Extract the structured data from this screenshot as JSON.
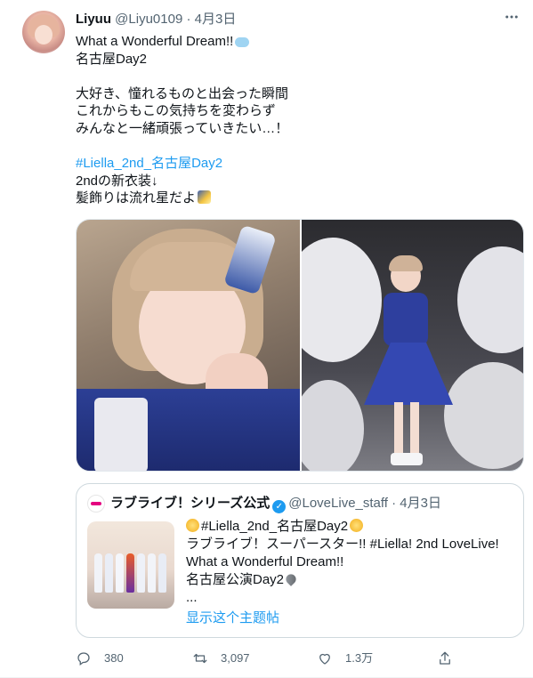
{
  "author": {
    "name": "Liyuu",
    "handle": "@Liyu0109",
    "separator": "·",
    "date": "4月3日"
  },
  "tweet": {
    "line1": "What a Wonderful Dream!!",
    "line2": "名古屋Day2",
    "line3": "大好き、憧れるものと出会った瞬間",
    "line4": "これからもこの気持ちを変わらず",
    "line5": "みんなと一緒頑張っていきたい…！",
    "hashtag": "#Liella_2nd_名古屋Day2",
    "line6": "2ndの新衣装↓",
    "line7": "髪飾りは流れ星だよ"
  },
  "quote": {
    "name": "ラブライブ！シリーズ公式",
    "handle": "@LoveLive_staff",
    "separator": "·",
    "date": "4月3日",
    "hashtag1": "#Liella_2nd_名古屋Day2",
    "line2a": "ラブライブ！スーパースター!! ",
    "hashtag2": "#Liella",
    "line2b": "! 2nd LoveLive!",
    "line3": "What a Wonderful Dream!!",
    "line4": "名古屋公演Day2",
    "ellipsis": "...",
    "thread_link": "显示这个主题帖"
  },
  "actions": {
    "reply_count": "380",
    "retweet_count": "3,097",
    "like_count": "1.3万"
  },
  "colors": {
    "accent": "#1d9bf0",
    "muted": "#536471",
    "text": "#0f1419"
  },
  "icons": [
    "more-icon",
    "verified-icon",
    "reply-icon",
    "retweet-icon",
    "like-icon",
    "share-icon"
  ]
}
